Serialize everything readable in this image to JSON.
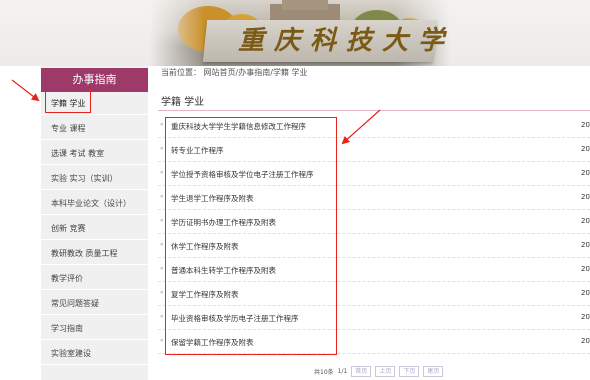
{
  "banner": {
    "calligraphy": "重庆科技大学"
  },
  "nav": {
    "title": "办事指南",
    "items": [
      {
        "label": "学籍 学业"
      },
      {
        "label": "专业 课程"
      },
      {
        "label": "选课 考试 教室"
      },
      {
        "label": "实验 实习（实训）"
      },
      {
        "label": "本科毕业论文（设计）"
      },
      {
        "label": "创新 竞赛"
      },
      {
        "label": "教研教改 质量工程"
      },
      {
        "label": "教学评价"
      },
      {
        "label": "常见问题答疑"
      },
      {
        "label": "学习指南"
      },
      {
        "label": "实验室建设"
      }
    ]
  },
  "breadcrumb": {
    "prefix": "当前位置：",
    "home": "网站首页",
    "sep1": "/",
    "section": "办事指南",
    "sep2": "/",
    "current": "学籍 学业"
  },
  "main": {
    "title": "学籍 学业",
    "list": [
      {
        "title": "重庆科技大学学生学籍信息修改工作程序",
        "date": "20"
      },
      {
        "title": "转专业工作程序",
        "date": "20"
      },
      {
        "title": "学位授予资格审核及学位电子注册工作程序",
        "date": "20"
      },
      {
        "title": "学生退学工作程序及附表",
        "date": "20"
      },
      {
        "title": "学历证明书办理工作程序及附表",
        "date": "20"
      },
      {
        "title": "休学工作程序及附表",
        "date": "20"
      },
      {
        "title": "普通本科生转学工作程序及附表",
        "date": "20"
      },
      {
        "title": "复学工作程序及附表",
        "date": "20"
      },
      {
        "title": "毕业资格审核及学历电子注册工作程序",
        "date": "20"
      },
      {
        "title": "保留学籍工作程序及附表",
        "date": "20"
      }
    ]
  },
  "pager": {
    "total": "共10条",
    "page": "1/1",
    "first": "首页",
    "prev": "上页",
    "next": "下页",
    "last": "尾页"
  },
  "colors": {
    "nav_title_bg": "#9d3a6a",
    "annotation_red": "#e8231d"
  }
}
